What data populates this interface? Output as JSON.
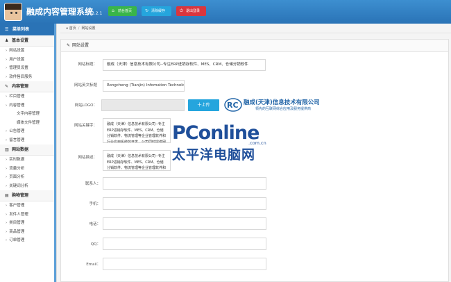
{
  "header": {
    "app_title": "融成内容管理系统",
    "version": "V 3.2.1",
    "buttons": [
      {
        "label": "前台首页",
        "icon": "home-icon"
      },
      {
        "label": "清除缓存",
        "icon": "refresh-icon"
      },
      {
        "label": "退出登录",
        "icon": "power-icon"
      }
    ]
  },
  "sidebar": {
    "menu_title": "菜单列表",
    "groups": [
      {
        "label": "基本设置",
        "icon": "user-icon",
        "items": [
          "网站设置",
          "用户设置",
          "管理员设置",
          "软件售后服务"
        ]
      },
      {
        "label": "内容管理",
        "icon": "edit-icon",
        "items": [
          "栏目管理",
          "内容管理"
        ],
        "subitems": [
          "文字内容管理",
          "媒体文件管理"
        ],
        "items_after": [
          "公告管理",
          "留言管理"
        ]
      },
      {
        "label": "网站数据",
        "icon": "chart-icon",
        "items": [
          "实时数据",
          "流量分析",
          "页面分析",
          "关键词分析"
        ]
      },
      {
        "label": "购物管理",
        "icon": "cart-icon",
        "items": [
          "客户管理",
          "发件人管理",
          "类目管理",
          "商品管理",
          "订单管理"
        ]
      }
    ]
  },
  "breadcrumb": {
    "home": "首页",
    "current": "网站设置"
  },
  "panel": {
    "title": "网站设置",
    "fields": {
      "site_title_label": "网站标题：",
      "site_title_value": "融成（天津）信息技术有限公司--专注ERP进销存软件、MES、CRM、仓储分销软件",
      "site_en_title_label": "网站英文标题",
      "site_en_title_value": "Rongcheng (Tianjin) Infomation Technology",
      "logo_label": "网站LOGO：",
      "upload_label": "十上传",
      "keywords_label": "网站关键字：",
      "keywords_value": "融成（天津）信息技术有限公司--专注ERP进销存软件、MES、CRM、仓储分销软件、物流管理等企业管理软件和行业应用系统的开发，公司同时提供网站建设、小程序开发----领先的互联网综合应用及服务提供商",
      "description_label": "网站描述：",
      "description_value": "融成（天津）信息技术有限公司--专注ERP进销存软件、MES、CRM、仓储分销软件、物流管理等企业管理软件和行业应用系统的开发，公司同时提供网站建设、小程序开发----领先的互联网综合应用及服务提供商",
      "contact_label": "联系人：",
      "phone_label": "手机：",
      "tel_label": "电话：",
      "qq_label": "QQ：",
      "email_label": "Email："
    },
    "company_logo": {
      "name": "融成(天津)信息技术有限公司",
      "tagline": "领先的互联网综合应用及服务提供商"
    }
  },
  "watermark": {
    "brand": "PConline",
    "domain": ".com.cn",
    "cn": "太平洋电脑网"
  },
  "colors": {
    "header": "#2a73b6",
    "green": "#39b54a",
    "blue": "#25a5dd",
    "red": "#d9363e"
  }
}
